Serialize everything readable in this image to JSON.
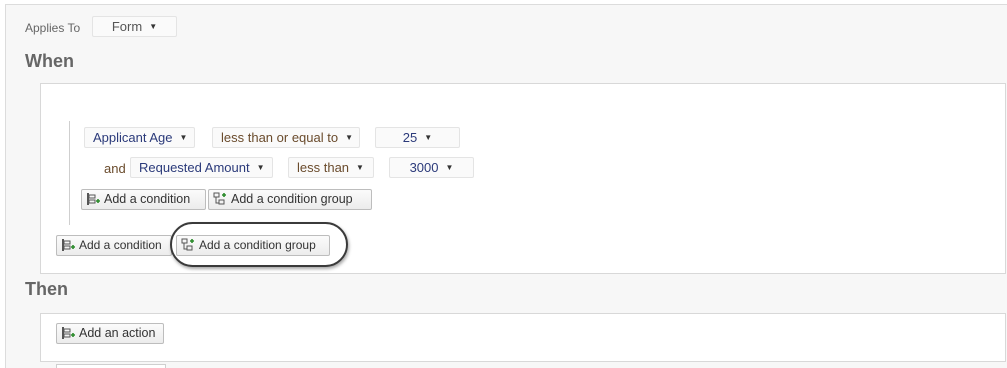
{
  "applies_to": {
    "label": "Applies To",
    "value": "Form"
  },
  "when": {
    "heading": "When",
    "group": {
      "condition1": {
        "field": "Applicant Age",
        "operator": "less than or equal to",
        "value": "25"
      },
      "condition2": {
        "connector": "and",
        "field": "Requested Amount",
        "operator": "less than",
        "value": "3000"
      },
      "add_condition_label": "Add a condition",
      "add_condition_group_label": "Add a condition group"
    },
    "add_condition_label": "Add a condition",
    "add_condition_group_label": "Add a condition group"
  },
  "then": {
    "heading": "Then",
    "add_action_label": "Add an action"
  },
  "colors": {
    "field_text": "#2b3a7a",
    "operator_text": "#6a4b2c",
    "heading": "#666666",
    "highlight_ring": "#3a3a3a"
  }
}
